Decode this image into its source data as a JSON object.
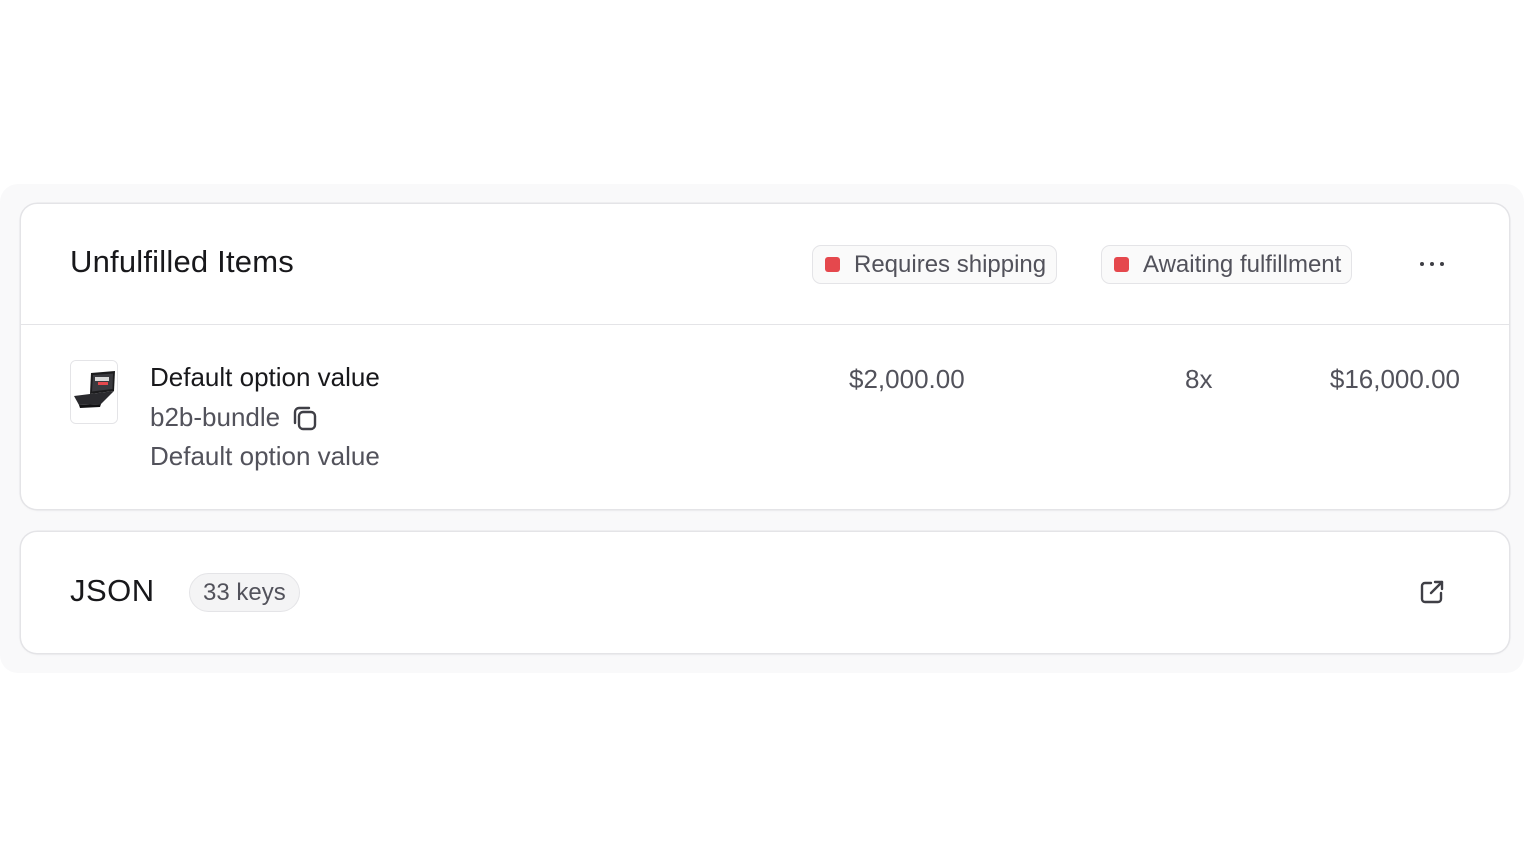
{
  "fulfillment_card": {
    "title": "Unfulfilled Items",
    "badges": [
      {
        "label": "Requires shipping",
        "color": "#e5484d"
      },
      {
        "label": "Awaiting fulfillment",
        "color": "#e5484d"
      }
    ],
    "more_icon": "more-horizontal-icon"
  },
  "line_item": {
    "thumbnail": "laptop-product-image",
    "title": "Default option value",
    "sku": "b2b-bundle",
    "copy_icon": "copy-icon",
    "variant": "Default option value",
    "unit_price": "$2,000.00",
    "quantity": "8x",
    "total": "$16,000.00"
  },
  "json_card": {
    "title": "JSON",
    "keys_count": "33 keys",
    "open_icon": "external-link-icon"
  },
  "colors": {
    "status_red": "#e5484d",
    "text_primary": "#18181b",
    "text_secondary": "#52525b",
    "border": "#e4e4e7"
  }
}
